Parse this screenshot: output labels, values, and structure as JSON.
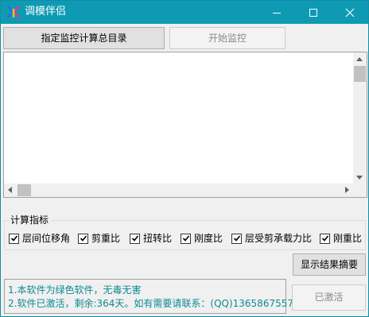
{
  "window": {
    "title": "调模伴侣",
    "icon": "app-logo-icon",
    "controls": [
      "minimize-icon",
      "maximize-icon",
      "close-icon"
    ],
    "accent_color": "#0e9ab3"
  },
  "toolbar": {
    "select_dir_label": "指定监控计算总目录",
    "start_monitor_label": "开始监控",
    "start_monitor_enabled": false
  },
  "output": {
    "text": ""
  },
  "indicators": {
    "title": "计算指标",
    "items": [
      {
        "label": "层间位移角",
        "checked": true
      },
      {
        "label": "剪重比",
        "checked": true
      },
      {
        "label": "扭转比",
        "checked": true
      },
      {
        "label": "刚度比",
        "checked": true
      },
      {
        "label": "层受剪承载力比",
        "checked": true
      },
      {
        "label": "刚重比",
        "checked": true
      }
    ]
  },
  "actions": {
    "summary_label": "显示结果摘要",
    "activated_label": "已激活",
    "activated_enabled": false
  },
  "info": {
    "line1": "1.本软件为绿色软件，无毒无害",
    "line2": "2.软件已激活，剩余:364天。如有需要请联系：(QQ)1365867557",
    "text_color": "#0e8a93"
  }
}
